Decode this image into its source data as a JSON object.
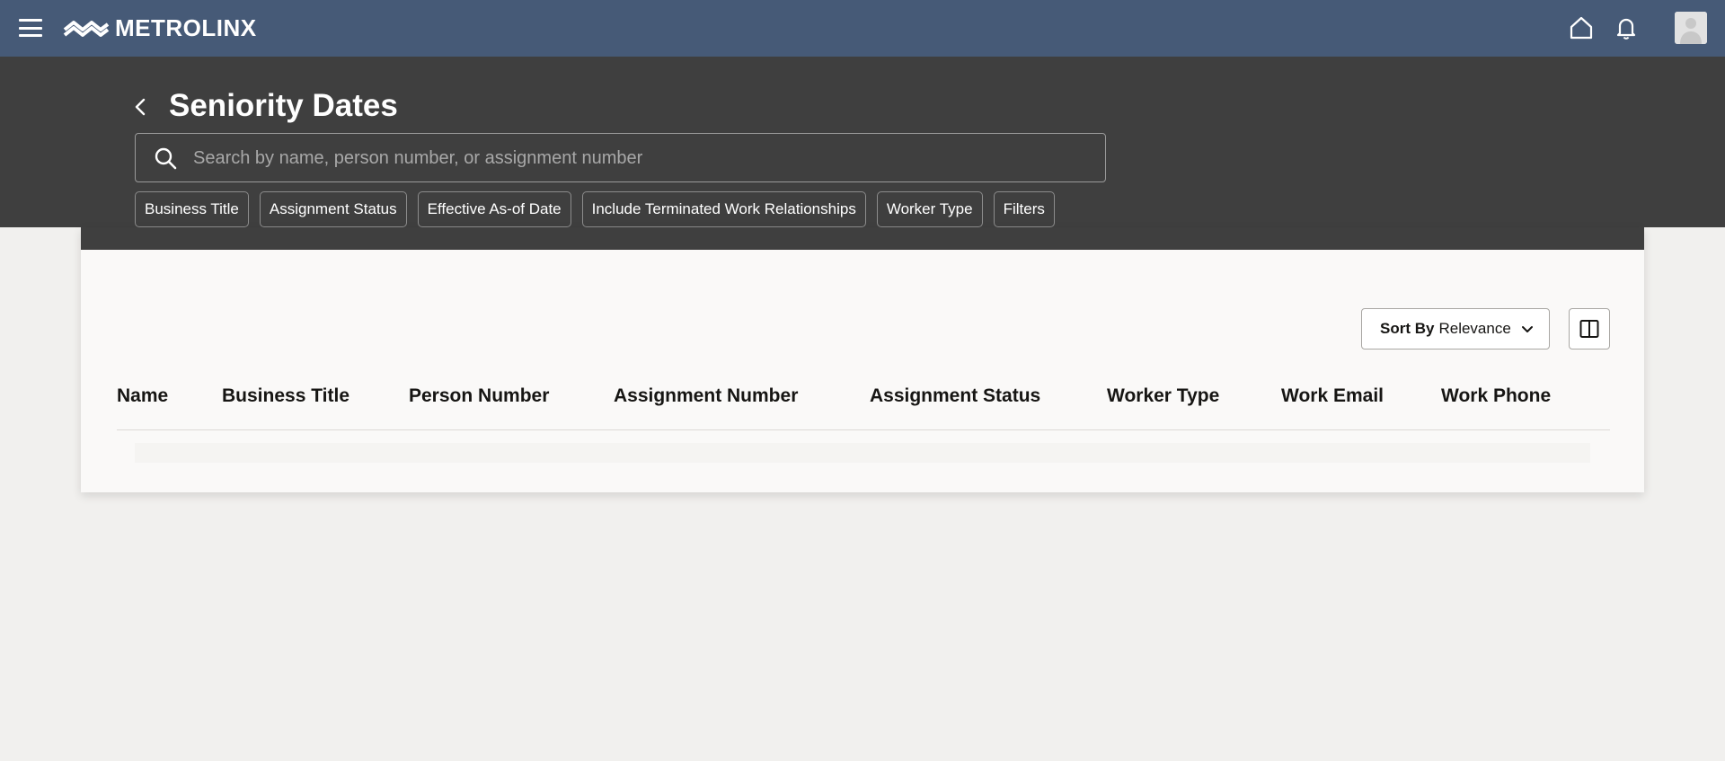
{
  "topbar": {
    "logo_text": "METROLINX",
    "icons": [
      "hamburger-menu-icon",
      "home-icon",
      "bell-icon",
      "avatar"
    ]
  },
  "header": {
    "title": "Seniority Dates",
    "search_placeholder": "Search by name, person number, or assignment number",
    "filter_chips": [
      "Business Title",
      "Assignment Status",
      "Effective As-of Date",
      "Include Terminated Work Relationships",
      "Worker Type",
      "Filters"
    ]
  },
  "toolbar": {
    "sort_label": "Sort By",
    "sort_value": "Relevance"
  },
  "table": {
    "columns": [
      "Name",
      "Business Title",
      "Person Number",
      "Assignment Number",
      "Assignment Status",
      "Worker Type",
      "Work Email",
      "Work Phone"
    ],
    "rows": []
  },
  "colors": {
    "topbar": "#465a77",
    "header": "#3f3f3f",
    "page_bg": "#f1f0ee",
    "card_bg": "#faf9f8"
  }
}
